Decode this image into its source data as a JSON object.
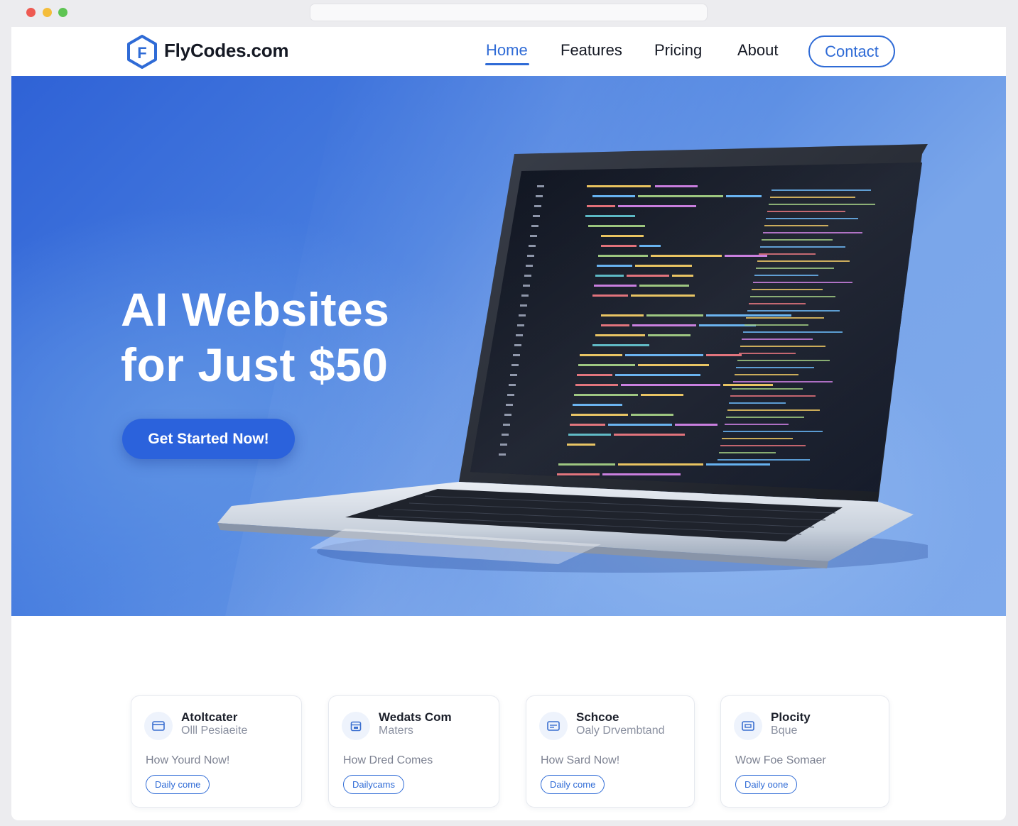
{
  "browser": {
    "controls": [
      "close",
      "minimize",
      "maximize"
    ],
    "address_bar": ""
  },
  "navbar": {
    "logo_letter": "F",
    "brand": "FlyCodes.com",
    "links": [
      {
        "label": "Home",
        "active": true
      },
      {
        "label": "Features",
        "active": false
      },
      {
        "label": "Pricing",
        "active": false
      },
      {
        "label": "About",
        "active": false
      }
    ],
    "contact_label": "Contact"
  },
  "hero": {
    "title_line1": "AI Websites",
    "title_line2": "for Just $50",
    "cta_label": "Get Started Now!",
    "image": "laptop-with-code-editor"
  },
  "cards": [
    {
      "icon": "card-icon",
      "title": "Atoltcater",
      "subtitle": "Olll Pesiaeite",
      "text": "How Yourd Now!",
      "button": "Daily come"
    },
    {
      "icon": "calendar-icon",
      "title": "Wedats Com",
      "subtitle": "Maters",
      "text": "How Dred Comes",
      "button": "Dailycams"
    },
    {
      "icon": "card-icon",
      "title": "Schcoe",
      "subtitle": "Oaly Drvembtand",
      "text": "How Sard Now!",
      "button": "Daily come"
    },
    {
      "icon": "card-icon",
      "title": "Plocity",
      "subtitle": "Bque",
      "text": "Wow Foe Somaer",
      "button": "Daily oone"
    }
  ],
  "colors": {
    "accent": "#2f6bd6",
    "cta": "#2b62dc",
    "hero_start": "#2f62d6",
    "hero_end": "#7ea9eb"
  }
}
